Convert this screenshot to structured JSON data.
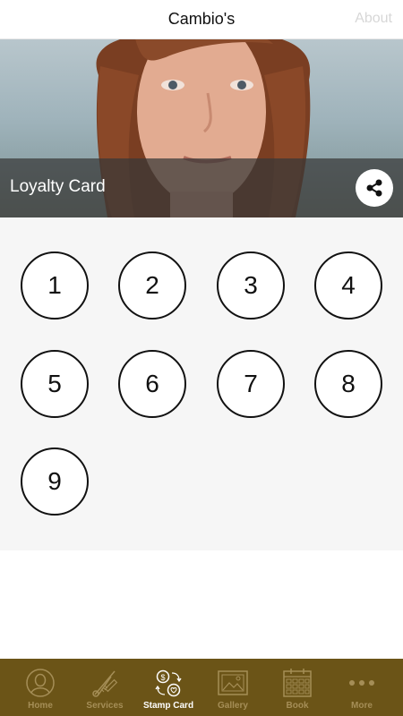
{
  "header": {
    "title": "Cambio's",
    "about_label": "About"
  },
  "hero": {
    "label": "Loyalty Card"
  },
  "stamps": [
    "1",
    "2",
    "3",
    "4",
    "5",
    "6",
    "7",
    "8",
    "9"
  ],
  "tabs": [
    {
      "label": "Home",
      "icon": "person-icon",
      "active": false
    },
    {
      "label": "Services",
      "icon": "scissors-comb-icon",
      "active": false
    },
    {
      "label": "Stamp Card",
      "icon": "stamp-card-icon",
      "active": true
    },
    {
      "label": "Gallery",
      "icon": "gallery-icon",
      "active": false
    },
    {
      "label": "Book",
      "icon": "calendar-icon",
      "active": false
    },
    {
      "label": "More",
      "icon": "more-dots-icon",
      "active": false
    }
  ],
  "colors": {
    "tabbar": "#6b5417",
    "tab_inactive": "#a58e57",
    "tab_active": "#ffffff"
  }
}
